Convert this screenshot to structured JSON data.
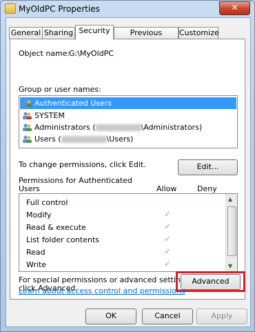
{
  "window": {
    "title": "MyOldPC Properties",
    "close_glyph": "✕"
  },
  "tabs": [
    "General",
    "Sharing",
    "Security",
    "Previous Versions",
    "Customize"
  ],
  "security": {
    "object_name_label": "Object name:",
    "object_name_value": "G:\\MyOldPC",
    "group_label": "Group or user names:",
    "groups": [
      {
        "name": "Authenticated Users",
        "icon": "users-icon",
        "selected": true
      },
      {
        "name": "SYSTEM",
        "icon": "users-icon"
      },
      {
        "name_prefix": "Administrators (",
        "name_suffix": "\\Administrators)",
        "icon": "users-icon"
      },
      {
        "name_prefix": "Users (",
        "name_suffix": "\\Users)",
        "icon": "users-icon"
      }
    ],
    "change_text": "To change permissions, click Edit.",
    "edit_button": "Edit...",
    "permissions_for": "Permissions for Authenticated",
    "permissions_for_2": "Users",
    "allow_header": "Allow",
    "deny_header": "Deny",
    "permissions": [
      {
        "name": "Full control",
        "allow": false
      },
      {
        "name": "Modify",
        "allow": true
      },
      {
        "name": "Read & execute",
        "allow": true
      },
      {
        "name": "List folder contents",
        "allow": true
      },
      {
        "name": "Read",
        "allow": true
      },
      {
        "name": "Write",
        "allow": true
      }
    ],
    "special_text_1": "For special permissions or advanced settings,",
    "special_text_2": "click Advanced.",
    "advanced_button": "Advanced",
    "learn_link": "Learn about access control and permissions",
    "check_glyph": "✓"
  },
  "footer": {
    "ok": "OK",
    "cancel": "Cancel",
    "apply": "Apply"
  },
  "colors": {
    "highlight": "#d91f26",
    "selection": "#3399ff",
    "link": "#0066cc"
  }
}
